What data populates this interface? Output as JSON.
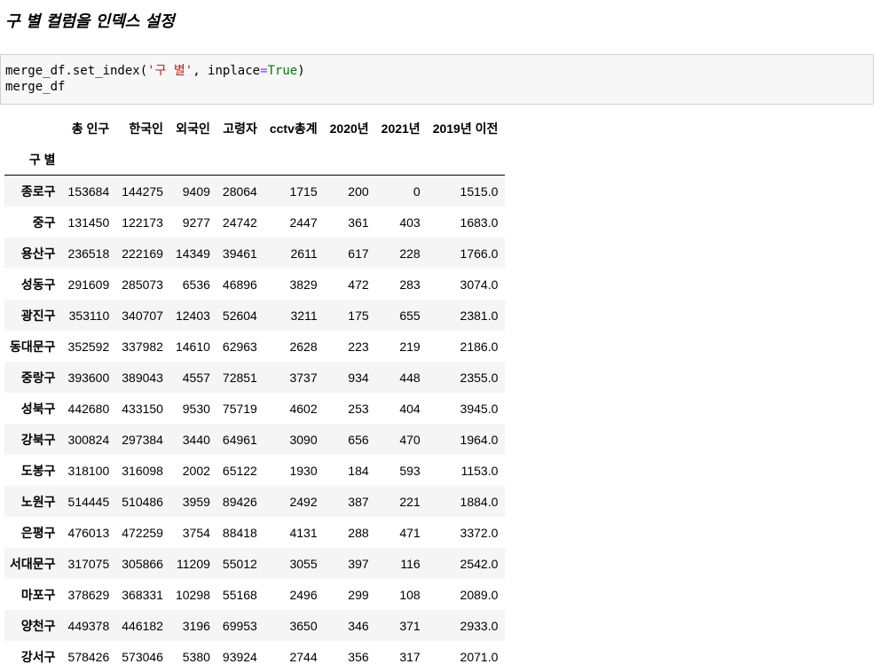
{
  "heading": "구 별 컬럼을 인덱스 설정",
  "code": {
    "line1_func": "merge_df.set_index(",
    "line1_str": "'구 별'",
    "line1_sep": ", inplace",
    "line1_eq": "=",
    "line1_kw": "True",
    "line1_end": ")",
    "line2": "merge_df"
  },
  "table": {
    "columns": [
      "총 인구",
      "한국인",
      "외국인",
      "고령자",
      "cctv총계",
      "2020년",
      "2021년",
      "2019년 이전"
    ],
    "index_name": "구 별",
    "rows": [
      {
        "idx": "종로구",
        "cells": [
          "153684",
          "144275",
          "9409",
          "28064",
          "1715",
          "200",
          "0",
          "1515.0"
        ]
      },
      {
        "idx": "중구",
        "cells": [
          "131450",
          "122173",
          "9277",
          "24742",
          "2447",
          "361",
          "403",
          "1683.0"
        ]
      },
      {
        "idx": "용산구",
        "cells": [
          "236518",
          "222169",
          "14349",
          "39461",
          "2611",
          "617",
          "228",
          "1766.0"
        ]
      },
      {
        "idx": "성동구",
        "cells": [
          "291609",
          "285073",
          "6536",
          "46896",
          "3829",
          "472",
          "283",
          "3074.0"
        ]
      },
      {
        "idx": "광진구",
        "cells": [
          "353110",
          "340707",
          "12403",
          "52604",
          "3211",
          "175",
          "655",
          "2381.0"
        ]
      },
      {
        "idx": "동대문구",
        "cells": [
          "352592",
          "337982",
          "14610",
          "62963",
          "2628",
          "223",
          "219",
          "2186.0"
        ]
      },
      {
        "idx": "중랑구",
        "cells": [
          "393600",
          "389043",
          "4557",
          "72851",
          "3737",
          "934",
          "448",
          "2355.0"
        ]
      },
      {
        "idx": "성북구",
        "cells": [
          "442680",
          "433150",
          "9530",
          "75719",
          "4602",
          "253",
          "404",
          "3945.0"
        ]
      },
      {
        "idx": "강북구",
        "cells": [
          "300824",
          "297384",
          "3440",
          "64961",
          "3090",
          "656",
          "470",
          "1964.0"
        ]
      },
      {
        "idx": "도봉구",
        "cells": [
          "318100",
          "316098",
          "2002",
          "65122",
          "1930",
          "184",
          "593",
          "1153.0"
        ]
      },
      {
        "idx": "노원구",
        "cells": [
          "514445",
          "510486",
          "3959",
          "89426",
          "2492",
          "387",
          "221",
          "1884.0"
        ]
      },
      {
        "idx": "은평구",
        "cells": [
          "476013",
          "472259",
          "3754",
          "88418",
          "4131",
          "288",
          "471",
          "3372.0"
        ]
      },
      {
        "idx": "서대문구",
        "cells": [
          "317075",
          "305866",
          "11209",
          "55012",
          "3055",
          "397",
          "116",
          "2542.0"
        ]
      },
      {
        "idx": "마포구",
        "cells": [
          "378629",
          "368331",
          "10298",
          "55168",
          "2496",
          "299",
          "108",
          "2089.0"
        ]
      },
      {
        "idx": "양천구",
        "cells": [
          "449378",
          "446182",
          "3196",
          "69953",
          "3650",
          "346",
          "371",
          "2933.0"
        ]
      },
      {
        "idx": "강서구",
        "cells": [
          "578426",
          "573046",
          "5380",
          "93924",
          "2744",
          "356",
          "317",
          "2071.0"
        ]
      }
    ]
  }
}
